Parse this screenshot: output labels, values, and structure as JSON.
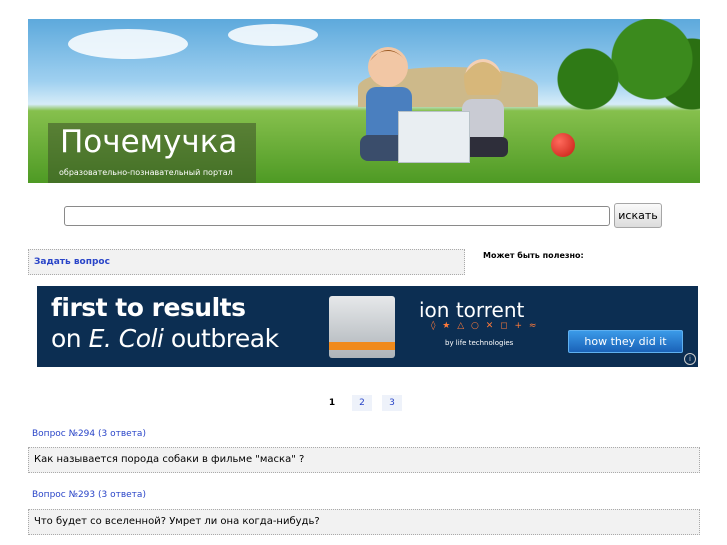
{
  "header": {
    "title": "Почемучка",
    "subtitle": "образовательно-познавательный портал"
  },
  "search": {
    "value": "",
    "button_label": "искать"
  },
  "ask": {
    "label": "Задать вопрос"
  },
  "sidebar": {
    "heading": "Может быть полезно:"
  },
  "ad": {
    "line1": "first to results",
    "line2_prefix": "on ",
    "line2_italic": "E. Coli",
    "line2_suffix": " outbreak",
    "brand": "ion torrent",
    "symbols": "◊ ★ △ ○ ✕ ◻ + ≈",
    "by": "by life technologies",
    "button": "how they did it",
    "info": "i"
  },
  "pager": {
    "pages": [
      "1",
      "2",
      "3"
    ],
    "current": "1"
  },
  "questions": [
    {
      "meta": "Вопрос №294 (3 ответа)",
      "text": "Как называется порода собаки в фильме \"маска\" ?"
    },
    {
      "meta": "Вопрос №293 (3 ответа)",
      "text": "Что будет со вселенной? Умрет ли она когда-нибудь?"
    }
  ]
}
